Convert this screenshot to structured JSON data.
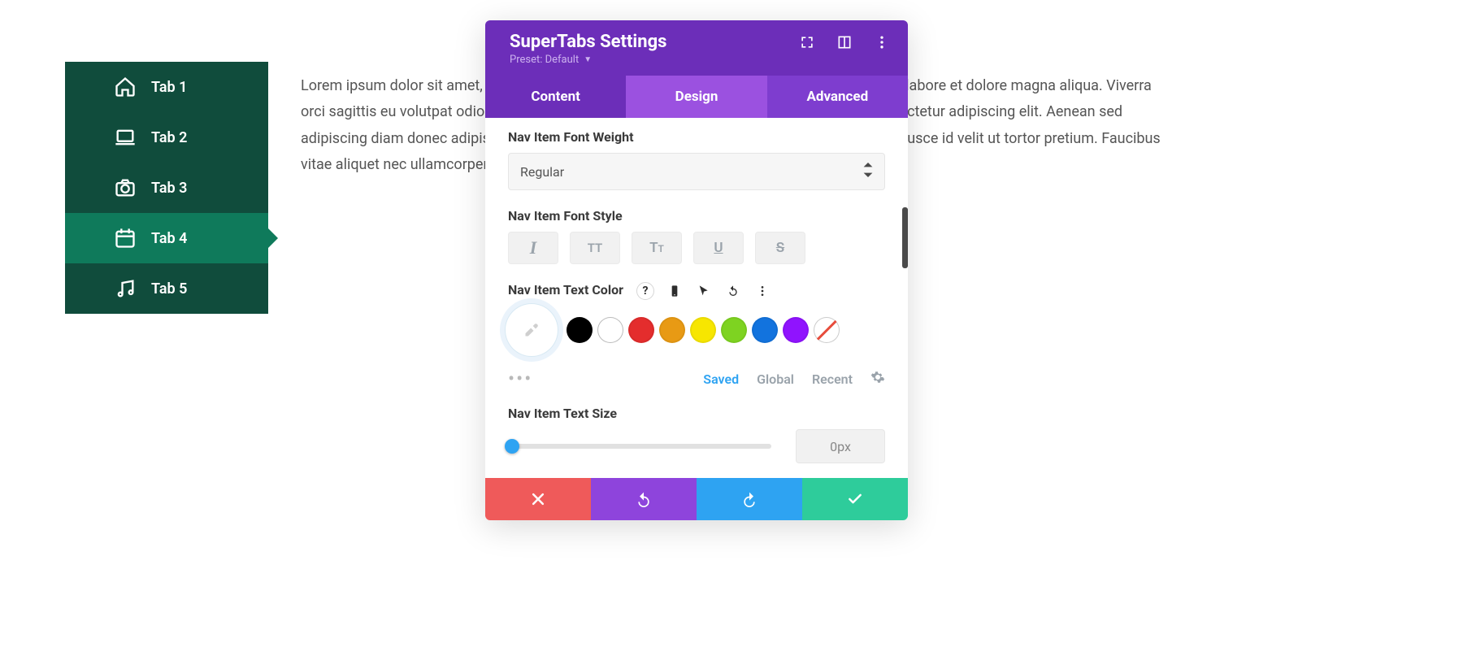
{
  "tabs": {
    "items": [
      {
        "label": "Tab 1",
        "icon": "home-icon"
      },
      {
        "label": "Tab 2",
        "icon": "laptop-icon"
      },
      {
        "label": "Tab 3",
        "icon": "camera-icon"
      },
      {
        "label": "Tab 4",
        "icon": "calendar-icon"
      },
      {
        "label": "Tab 5",
        "icon": "music-icon"
      }
    ],
    "active_index": 3
  },
  "body_text": "Lorem ipsum dolor sit amet, consectetur adipiscing elit, sed do eiusmod tempor incididunt ut labore et dolore magna aliqua. Viverra orci sagittis eu volutpat odio facilisis mauris sit amet. Imperdiet dui accumsan sit amet consectetur adipiscing elit. Aenean sed adipiscing diam donec adipiscing. Egestas sed sed risus pretium quam vulputate dignissim. Fusce id velit ut tortor pretium. Faucibus vitae aliquet nec ullamcorper sit amet risus.",
  "panel": {
    "title": "SuperTabs Settings",
    "preset_label": "Preset: Default",
    "tabs": [
      {
        "label": "Content"
      },
      {
        "label": "Design"
      },
      {
        "label": "Advanced"
      }
    ],
    "active_tab_index": 1,
    "fields": {
      "font_weight": {
        "label": "Nav Item Font Weight",
        "value": "Regular"
      },
      "font_style": {
        "label": "Nav Item Font Style"
      },
      "text_color": {
        "label": "Nav Item Text Color"
      },
      "text_size": {
        "label": "Nav Item Text Size",
        "value": "0px",
        "slider_pct": 0
      }
    },
    "swatches": [
      "#000000",
      "#ffffff",
      "#e42d2d",
      "#e89a14",
      "#f7e600",
      "#7ed321",
      "#1273de",
      "#9013fe"
    ],
    "palette_tabs": {
      "saved": "Saved",
      "global": "Global",
      "recent": "Recent",
      "active": "saved"
    }
  }
}
